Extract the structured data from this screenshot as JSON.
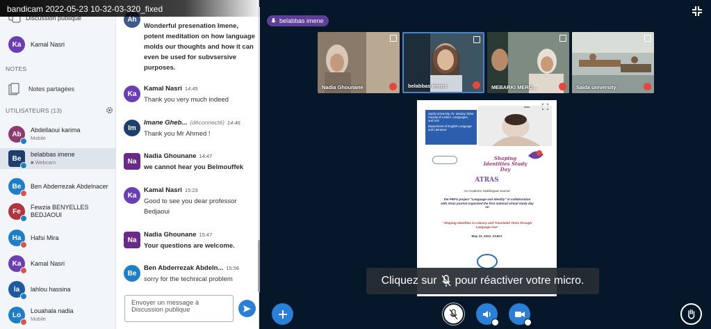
{
  "window": {
    "title": "bandicam 2022-05-23 10-32-03-320_fixed"
  },
  "sidebar": {
    "public_chat": "Discussion publique",
    "top_user": {
      "initials": "Ka",
      "name": "Kamal Nasri"
    },
    "notes_title": "NOTES",
    "shared_notes": "Notes partagées",
    "users_title": "UTILISATEURS (13)",
    "users": [
      {
        "initials": "Ab",
        "name": "Abdellaoui karima",
        "sub": "Mobile"
      },
      {
        "initials": "Be",
        "name": "belabbas imene",
        "sub": "Webcam"
      },
      {
        "initials": "Be",
        "name": "Ben Abderrezak Abdelnacer",
        "sub": ""
      },
      {
        "initials": "Fe",
        "name": "Fewzia BENYELLES BEDJAOUI",
        "sub": ""
      },
      {
        "initials": "Ha",
        "name": "Hafsi Mira",
        "sub": ""
      },
      {
        "initials": "Ka",
        "name": "Kamal Nasri",
        "sub": ""
      },
      {
        "initials": "la",
        "name": "lahlou hassina",
        "sub": ""
      },
      {
        "initials": "Lo",
        "name": "Louahala nadia",
        "sub": "Mobile"
      }
    ]
  },
  "chat": {
    "messages": [
      {
        "initials": "Ah",
        "name": "Ahmed Kezzi...",
        "time": "",
        "status": "",
        "text": "Wonderful presenation Imene, potent meditation on how language molds our thoughts and how it can even be used for subvsersive purposes."
      },
      {
        "initials": "Ka",
        "name": "Kamal Nasri",
        "time": "14:45",
        "status": "",
        "text": "Thank you very much indeed"
      },
      {
        "initials": "Im",
        "name": "Imane Gheb...",
        "time": "14:46",
        "status": "(déconnecté)",
        "text": "Thank you Mr Ahmed !"
      },
      {
        "initials": "Na",
        "name": "Nadia Ghounane",
        "time": "14:47",
        "status": "",
        "text": "we cannot hear you Belmouffek"
      },
      {
        "initials": "Ka",
        "name": "Kamal Nasri",
        "time": "15:23",
        "status": "",
        "text": "Good to see you dear professor Bedjaoui"
      },
      {
        "initials": "Na",
        "name": "Nadia Ghounane",
        "time": "15:47",
        "status": "",
        "text": "Your questions are welcome."
      },
      {
        "initials": "Be",
        "name": "Ben Abderrezak Abdeln...",
        "time": "15:56",
        "status": "",
        "text": "sorry for the technical problem"
      }
    ],
    "input_placeholder": "Envoyer un message à Discussion publique"
  },
  "stage": {
    "talking": "belabbas imene",
    "videos": [
      {
        "name": "Nadia Ghounane"
      },
      {
        "name": "belabbas imene"
      },
      {
        "name": "MEBARKI MERO..."
      },
      {
        "name": "Saida university"
      }
    ],
    "slide": {
      "header": "Saida University, Dr. Moulay Tahar Faculty of Letters, Languages, and Arts",
      "subheader": "Department of English Language and Literature",
      "event": "Shaping Identities Study Day",
      "journal": "ATRAS",
      "journal_sub": "An Academic Multilingual Journal",
      "body": "the PRFU project \"Language and Identity\" in collaboration with Atras journal organized the first national virtual study day on",
      "topic": "\"Shaping Identities in Literary and Translated Texts through Language Use\"",
      "date": "May 23, 2022, SAIDA"
    },
    "toast": {
      "before": "Cliquez sur",
      "after": "pour réactiver votre micro."
    }
  },
  "colors": {
    "stage_bg": "#06172a",
    "primary": "#2a80d6",
    "pill": "#5d3f97",
    "mute": "#e0493b"
  }
}
